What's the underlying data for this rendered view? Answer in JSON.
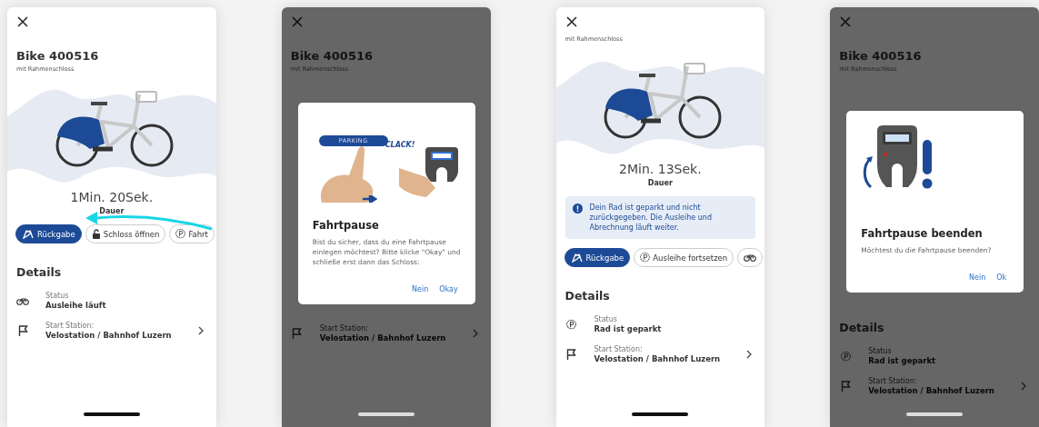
{
  "screens": [
    {
      "dimmed": false,
      "header": {
        "title": "Bike 400516",
        "subtitle": "mit Rahmenschloss"
      },
      "hero": {
        "duration": "1Min. 20Sek.",
        "duration_label": "Dauer"
      },
      "swipe_hint": true,
      "actions": [
        {
          "label": "Rückgabe",
          "kind": "return",
          "primary": true
        },
        {
          "label": "Schloss öffnen",
          "kind": "unlock",
          "primary": false
        },
        {
          "label": "Fahrt",
          "glyph": "Ⓟ",
          "kind": "pause",
          "primary": false
        }
      ],
      "details": {
        "title": "Details",
        "rows": [
          {
            "kind": "riding",
            "label": "Status",
            "value": "Ausleihe läuft",
            "link": false
          },
          {
            "kind": "station",
            "label": "Start Station:",
            "value": "Velostation / Bahnhof Luzern",
            "link": true
          }
        ]
      }
    },
    {
      "dimmed": true,
      "header": {
        "title": "Bike 400516",
        "subtitle": "mit Rahmenschloss"
      },
      "details": {
        "rows": [
          {
            "kind": "station",
            "label": "Start Station:",
            "value": "Velostation / Bahnhof Luzern",
            "link": true
          }
        ]
      },
      "dialog": {
        "kind": "pause",
        "labels": [
          "PARKING",
          "CLACK!"
        ],
        "title": "Fahrtpause",
        "message": "Bist du sicher, dass du eine Fahrtpause einlegen möchtest? Bitte klicke \"Okay\" und schließe erst dann das Schloss:",
        "buttons": [
          "Nein",
          "Okay"
        ]
      }
    },
    {
      "dimmed": false,
      "header": {
        "subtitle": "mit Rahmenschloss"
      },
      "hero": {
        "duration": "2Min. 13Sek.",
        "duration_label": "Dauer"
      },
      "swipe_hint": false,
      "notice": "Dein Rad ist geparkt und nicht zurückgegeben. Die Ausleihe und Abrechnung läuft weiter.",
      "actions": [
        {
          "label": "Rückgabe",
          "kind": "return",
          "primary": true
        },
        {
          "label": "Ausleihe fortsetzen",
          "glyph": "Ⓟ",
          "kind": "resume",
          "primary": false
        },
        {
          "kind": "riding",
          "primary": false
        }
      ],
      "details": {
        "title": "Details",
        "rows": [
          {
            "glyph": "Ⓟ",
            "kind": "parked",
            "label": "Status",
            "value": "Rad ist geparkt",
            "link": false
          },
          {
            "kind": "station",
            "label": "Start Station:",
            "value": "Velostation / Bahnhof Luzern",
            "link": true
          }
        ]
      }
    },
    {
      "dimmed": true,
      "header": {
        "title": "Bike 400516",
        "subtitle": "mit Rahmenschloss"
      },
      "details": {
        "title": "Details",
        "rows": [
          {
            "glyph": "Ⓟ",
            "kind": "parked",
            "label": "Status",
            "value": "Rad ist geparkt",
            "link": false
          },
          {
            "kind": "station",
            "label": "Start Station:",
            "value": "Velostation / Bahnhof Luzern",
            "link": true
          }
        ]
      },
      "dialog": {
        "kind": "end-pause",
        "title": "Fahrtpause beenden",
        "message": "Möchtest du die Fahrtpause beenden?",
        "buttons": [
          "Nein",
          "Ok"
        ]
      }
    }
  ]
}
